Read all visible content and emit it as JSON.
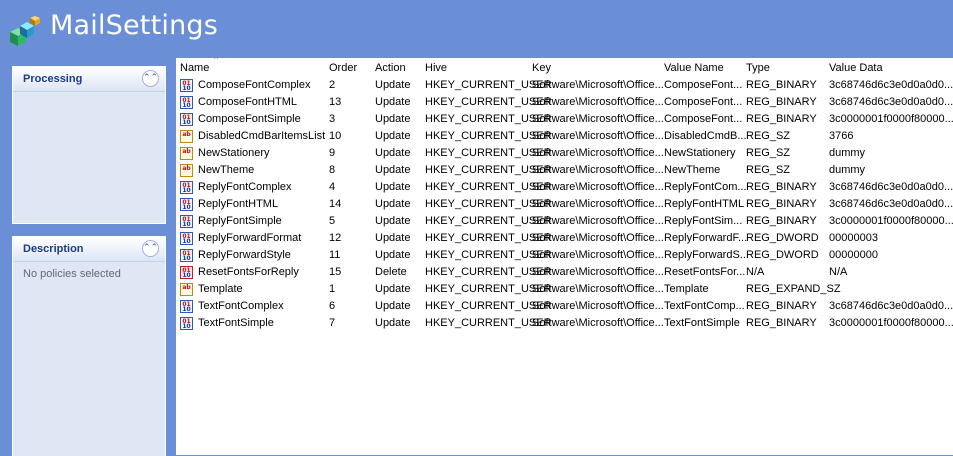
{
  "app": {
    "title": "MailSettings"
  },
  "panels": {
    "processing": {
      "title": "Processing"
    },
    "description": {
      "title": "Description",
      "text": "No policies selected"
    }
  },
  "table": {
    "columns": [
      "Name",
      "Order",
      "Action",
      "Hive",
      "Key",
      "Value Name",
      "Type",
      "Value Data"
    ],
    "rows": [
      {
        "name": "ComposeFontComplex",
        "order": "2",
        "action": "Update",
        "hive": "HKEY_CURRENT_USER",
        "key": "Software\\Microsoft\\Office...",
        "value_name": "ComposeFont...",
        "type": "REG_BINARY",
        "value_data": "3c68746d6c3e0d0a0d0...",
        "icon": "binary-value-icon"
      },
      {
        "name": "ComposeFontHTML",
        "order": "13",
        "action": "Update",
        "hive": "HKEY_CURRENT_USER",
        "key": "Software\\Microsoft\\Office...",
        "value_name": "ComposeFont...",
        "type": "REG_BINARY",
        "value_data": "3c68746d6c3e0d0a0d0...",
        "icon": "binary-value-icon"
      },
      {
        "name": "ComposeFontSimple",
        "order": "3",
        "action": "Update",
        "hive": "HKEY_CURRENT_USER",
        "key": "Software\\Microsoft\\Office...",
        "value_name": "ComposeFont...",
        "type": "REG_BINARY",
        "value_data": "3c0000001f0000f80000...",
        "icon": "binary-value-icon"
      },
      {
        "name": "DisabledCmdBarItemsList",
        "order": "10",
        "action": "Update",
        "hive": "HKEY_CURRENT_USER",
        "key": "Software\\Microsoft\\Office...",
        "value_name": "DisabledCmdB...",
        "type": "REG_SZ",
        "value_data": "3766",
        "icon": "string-value-icon"
      },
      {
        "name": "NewStationery",
        "order": "9",
        "action": "Update",
        "hive": "HKEY_CURRENT_USER",
        "key": "Software\\Microsoft\\Office...",
        "value_name": "NewStationery",
        "type": "REG_SZ",
        "value_data": "dummy",
        "icon": "string-value-icon"
      },
      {
        "name": "NewTheme",
        "order": "8",
        "action": "Update",
        "hive": "HKEY_CURRENT_USER",
        "key": "Software\\Microsoft\\Office...",
        "value_name": "NewTheme",
        "type": "REG_SZ",
        "value_data": "dummy",
        "icon": "string-value-icon"
      },
      {
        "name": "ReplyFontComplex",
        "order": "4",
        "action": "Update",
        "hive": "HKEY_CURRENT_USER",
        "key": "Software\\Microsoft\\Office...",
        "value_name": "ReplyFontCom...",
        "type": "REG_BINARY",
        "value_data": "3c68746d6c3e0d0a0d0...",
        "icon": "binary-value-icon"
      },
      {
        "name": "ReplyFontHTML",
        "order": "14",
        "action": "Update",
        "hive": "HKEY_CURRENT_USER",
        "key": "Software\\Microsoft\\Office...",
        "value_name": "ReplyFontHTML",
        "type": "REG_BINARY",
        "value_data": "3c68746d6c3e0d0a0d0...",
        "icon": "binary-value-icon"
      },
      {
        "name": "ReplyFontSimple",
        "order": "5",
        "action": "Update",
        "hive": "HKEY_CURRENT_USER",
        "key": "Software\\Microsoft\\Office...",
        "value_name": "ReplyFontSim...",
        "type": "REG_BINARY",
        "value_data": "3c0000001f0000f80000...",
        "icon": "binary-value-icon"
      },
      {
        "name": "ReplyForwardFormat",
        "order": "12",
        "action": "Update",
        "hive": "HKEY_CURRENT_USER",
        "key": "Software\\Microsoft\\Office...",
        "value_name": "ReplyForwardF...",
        "type": "REG_DWORD",
        "value_data": "00000003",
        "icon": "binary-value-icon"
      },
      {
        "name": "ReplyForwardStyle",
        "order": "11",
        "action": "Update",
        "hive": "HKEY_CURRENT_USER",
        "key": "Software\\Microsoft\\Office...",
        "value_name": "ReplyForwardS...",
        "type": "REG_DWORD",
        "value_data": "00000000",
        "icon": "binary-value-icon"
      },
      {
        "name": "ResetFontsForReply",
        "order": "15",
        "action": "Delete",
        "hive": "HKEY_CURRENT_USER",
        "key": "Software\\Microsoft\\Office...",
        "value_name": "ResetFontsFor...",
        "type": "N/A",
        "value_data": "N/A",
        "icon": "delete-value-icon"
      },
      {
        "name": "Template",
        "order": "1",
        "action": "Update",
        "hive": "HKEY_CURRENT_USER",
        "key": "Software\\Microsoft\\Office...",
        "value_name": "Template",
        "type": "REG_EXPAND_SZ",
        "value_data": "",
        "icon": "string-value-icon"
      },
      {
        "name": "TextFontComplex",
        "order": "6",
        "action": "Update",
        "hive": "HKEY_CURRENT_USER",
        "key": "Software\\Microsoft\\Office...",
        "value_name": "TextFontComp...",
        "type": "REG_BINARY",
        "value_data": "3c68746d6c3e0d0a0d0...",
        "icon": "binary-value-icon"
      },
      {
        "name": "TextFontSimple",
        "order": "7",
        "action": "Update",
        "hive": "HKEY_CURRENT_USER",
        "key": "Software\\Microsoft\\Office...",
        "value_name": "TextFontSimple",
        "type": "REG_BINARY",
        "value_data": "3c0000001f0000f80000...",
        "icon": "binary-value-icon"
      }
    ]
  },
  "colors": {
    "background": "#6b8fd6",
    "panel": "#dfe6f4",
    "panel_title": "#1a3c8c"
  }
}
